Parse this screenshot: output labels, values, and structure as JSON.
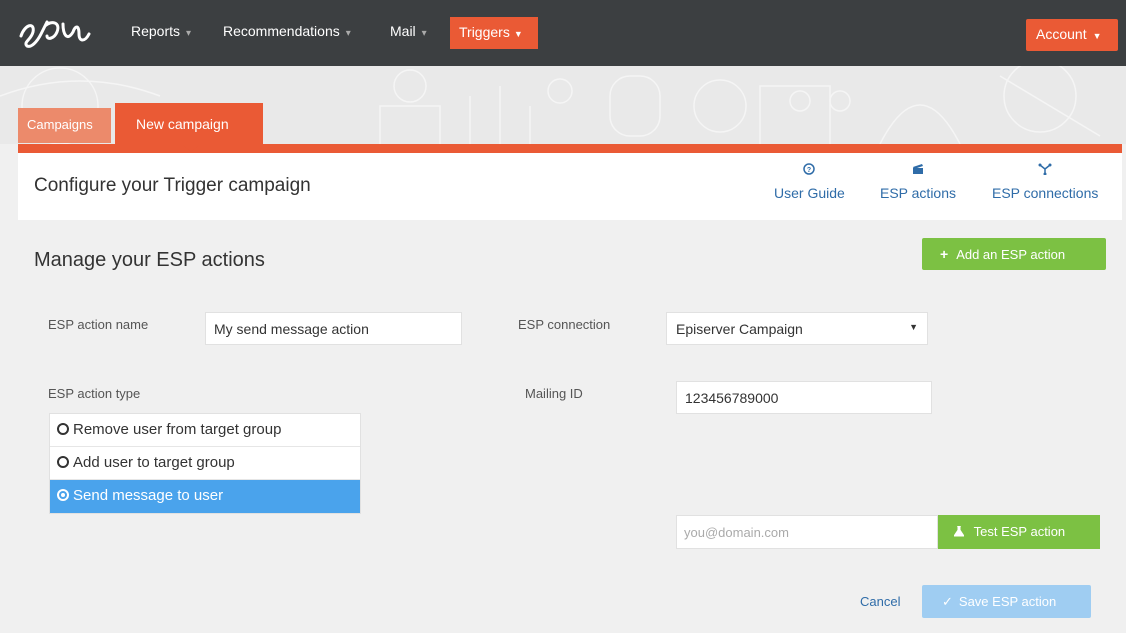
{
  "nav": {
    "reports": "Reports",
    "recommendations": "Recommendations",
    "mail": "Mail",
    "triggers": "Triggers",
    "account": "Account"
  },
  "tabs": {
    "campaigns": "Campaigns",
    "new_campaign": "New campaign"
  },
  "header": {
    "title": "Configure your Trigger campaign",
    "links": [
      {
        "label": "User Guide",
        "icon": "question-circle-icon"
      },
      {
        "label": "ESP actions",
        "icon": "clapperboard-icon"
      },
      {
        "label": "ESP connections",
        "icon": "network-icon"
      }
    ]
  },
  "section": {
    "title": "Manage your ESP actions",
    "add_button": "Add an ESP action"
  },
  "form": {
    "action_name_label": "ESP action name",
    "action_name_value": "My send message action",
    "connection_label": "ESP connection",
    "connection_value": "Episerver Campaign",
    "action_type_label": "ESP action type",
    "mailing_id_label": "Mailing ID",
    "mailing_id_value": "123456789000",
    "action_types": [
      {
        "label": "Remove user from target group",
        "selected": false
      },
      {
        "label": "Add user to target group",
        "selected": false
      },
      {
        "label": "Send message to user",
        "selected": true
      }
    ],
    "test_email_placeholder": "you@domain.com",
    "test_button": "Test ESP action",
    "cancel": "Cancel",
    "save_button": "Save ESP action"
  },
  "colors": {
    "nav_bg": "#3c3f41",
    "accent_orange": "#ea5a35",
    "green": "#7cc143",
    "selected_blue": "#4aa3ec",
    "link_blue": "#2f6ca8"
  }
}
